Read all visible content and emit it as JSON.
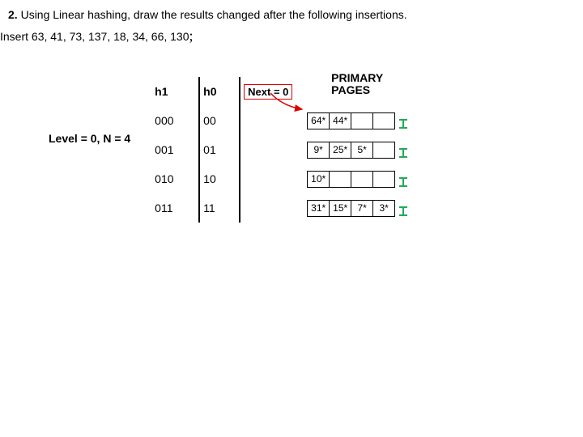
{
  "question": {
    "num": "2.",
    "text": "Using Linear hashing, draw the results changed after the following insertions."
  },
  "insert_line": "Insert 63, 41, 73, 137, 18, 34, 66, 130",
  "semicolon": ";",
  "level": "Level = 0, N = 4",
  "headers": {
    "h1": "h1",
    "h0": "h0",
    "next": "Next = 0",
    "primary1": "PRIMARY",
    "primary2": "PAGES"
  },
  "rows": [
    {
      "h1": "000",
      "h0": "00",
      "cells": [
        "64*",
        "44*",
        "",
        ""
      ],
      "term": true
    },
    {
      "h1": "001",
      "h0": "01",
      "cells": [
        "9*",
        "25*",
        "5*",
        ""
      ],
      "term": true
    },
    {
      "h1": "010",
      "h0": "10",
      "cells": [
        "10*",
        "",
        "",
        ""
      ],
      "term": true
    },
    {
      "h1": "011",
      "h0": "11",
      "cells": [
        "31*",
        "15*",
        "7*",
        "3*"
      ],
      "term": true
    }
  ]
}
